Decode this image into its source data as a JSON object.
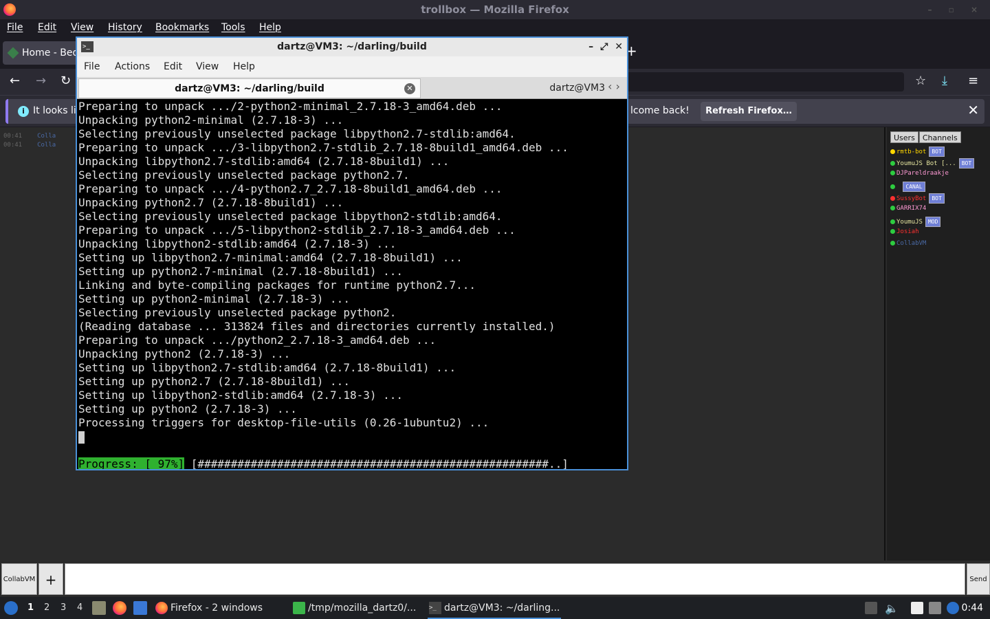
{
  "firefox": {
    "window_title": "trollbox — Mozilla Firefox",
    "menu": [
      "File",
      "Edit",
      "View",
      "History",
      "Bookmarks",
      "Tools",
      "Help"
    ],
    "tab_title": "Home - Bed",
    "notification_text_left": "It looks lik",
    "notification_text_right": "lcome back!",
    "refresh_button": "Refresh Firefox…"
  },
  "trollbox": {
    "chat_lines": [
      {
        "time": "00:41",
        "nick": "Colla"
      },
      {
        "time": "00:41",
        "nick": "Colla"
      }
    ],
    "user_tabs": [
      "Users",
      "Channels"
    ],
    "users": [
      {
        "name": "rmtb-bot",
        "color": "#ffd700",
        "badge": "BOT",
        "dot": "#ffd700"
      },
      {
        "name": "YoumuJS Bot [...",
        "color": "#e6e6a0",
        "badge": "BOT",
        "dot": "#2ecc40"
      },
      {
        "name": "DJPareldraakje",
        "color": "#ff9ad5",
        "badge": "",
        "dot": "#2ecc40"
      },
      {
        "name": " ",
        "color": "#6f7fd6",
        "badge": "CANAL",
        "dot": "#2ecc40"
      },
      {
        "name": "SussyBot",
        "color": "#ff3030",
        "badge": "BOT",
        "dot": "#ff3030"
      },
      {
        "name": "GARRIX74",
        "color": "#ff9ad5",
        "badge": "",
        "dot": "#2ecc40"
      },
      {
        "name": "YoumuJS",
        "color": "#e6e6a0",
        "badge": "MOD",
        "dot": "#2ecc40"
      },
      {
        "name": "Josiah",
        "color": "#ff3030",
        "badge": "",
        "dot": "#2ecc40"
      },
      {
        "name": "CollabVM",
        "color": "#4a6aa6",
        "badge": "",
        "dot": "#2ecc40"
      }
    ],
    "input_label": "CollabVM",
    "plus_label": "+",
    "send_label": "Send"
  },
  "terminal": {
    "title": "dartz@VM3: ~/darling/build",
    "menu": [
      "File",
      "Actions",
      "Edit",
      "View",
      "Help"
    ],
    "active_tab": "dartz@VM3: ~/darling/build",
    "other_tab": "dartz@VM3",
    "lines": [
      "Preparing to unpack .../2-python2-minimal_2.7.18-3_amd64.deb ...",
      "Unpacking python2-minimal (2.7.18-3) ...",
      "Selecting previously unselected package libpython2.7-stdlib:amd64.",
      "Preparing to unpack .../3-libpython2.7-stdlib_2.7.18-8build1_amd64.deb ...",
      "Unpacking libpython2.7-stdlib:amd64 (2.7.18-8build1) ...",
      "Selecting previously unselected package python2.7.",
      "Preparing to unpack .../4-python2.7_2.7.18-8build1_amd64.deb ...",
      "Unpacking python2.7 (2.7.18-8build1) ...",
      "Selecting previously unselected package libpython2-stdlib:amd64.",
      "Preparing to unpack .../5-libpython2-stdlib_2.7.18-3_amd64.deb ...",
      "Unpacking libpython2-stdlib:amd64 (2.7.18-3) ...",
      "Setting up libpython2.7-minimal:amd64 (2.7.18-8build1) ...",
      "Setting up python2.7-minimal (2.7.18-8build1) ...",
      "Linking and byte-compiling packages for runtime python2.7...",
      "Setting up python2-minimal (2.7.18-3) ...",
      "Selecting previously unselected package python2.",
      "(Reading database ... 313824 files and directories currently installed.)",
      "Preparing to unpack .../python2_2.7.18-3_amd64.deb ...",
      "Unpacking python2 (2.7.18-3) ...",
      "Setting up libpython2.7-stdlib:amd64 (2.7.18-8build1) ...",
      "Setting up python2.7 (2.7.18-8build1) ...",
      "Setting up libpython2-stdlib:amd64 (2.7.18-3) ...",
      "Setting up python2 (2.7.18-3) ...",
      "Processing triggers for desktop-file-utils (0.26-1ubuntu2) ..."
    ],
    "progress_label": "Progress: [ 97%]",
    "progress_bar": "[#####################################################..]",
    "progress_percent": 97
  },
  "taskbar": {
    "workspaces": [
      "1",
      "2",
      "3",
      "4"
    ],
    "items": [
      {
        "label": "Firefox - 2 windows",
        "icon": "firefox-icon"
      },
      {
        "label": "/tmp/mozilla_dartz0/...",
        "icon": "folder-icon"
      },
      {
        "label": "dartz@VM3: ~/darling...",
        "icon": "terminal-icon"
      }
    ],
    "clock": "0:44"
  }
}
